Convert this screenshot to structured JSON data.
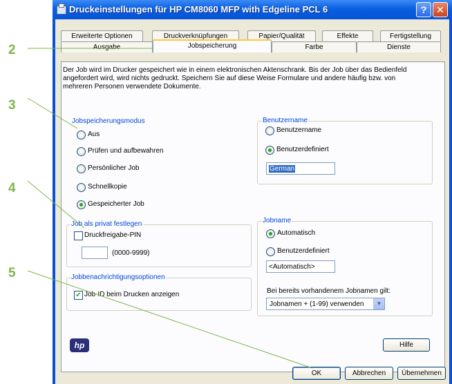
{
  "callouts": [
    "2",
    "3",
    "4",
    "5"
  ],
  "window": {
    "title": "Druckeinstellungen für HP CM8060 MFP with Edgeline PCL 6",
    "help_btn": "?",
    "close_btn": "✕"
  },
  "tabs_row1": [
    "Erweiterte Optionen",
    "Druckverknüpfungen",
    "Papier/Qualität",
    "Effekte",
    "Fertigstellung"
  ],
  "tabs_row2": [
    "Ausgabe",
    "Jobspeicherung",
    "Farbe",
    "Dienste"
  ],
  "description": "Der Job wird im Drucker gespeichert wie in einem elektronischen Aktenschrank. Bis der Job über das Bedienfeld angefordert wird, wird nichts gedruckt. Speichern Sie auf diese Weise Formulare und andere häufig bzw. von mehreren Personen verwendete Dokumente.",
  "mode_group": {
    "label": "Jobspeicherungsmodus",
    "options": [
      "Aus",
      "Prüfen und aufbewahren",
      "Persönlicher Job",
      "Schnellkopie",
      "Gespeicherter Job"
    ],
    "selected": "Gespeicherter Job"
  },
  "private_group": {
    "label": "Job als privat festlegen",
    "checkbox": "Druckfreigabe-PIN",
    "pin_value": "",
    "pin_hint": "(0000-9999)"
  },
  "notify_group": {
    "label": "Jobbenachrichtigungsoptionen",
    "checkbox": "Job-ID beim Drucken anzeigen",
    "checked": true
  },
  "user_group": {
    "label": "Benutzername",
    "options": [
      "Benutzername",
      "Benutzerdefiniert"
    ],
    "selected": "Benutzerdefiniert",
    "value": "German"
  },
  "jobname_group": {
    "label": "Jobname",
    "options": [
      "Automatisch",
      "Benutzerdefiniert"
    ],
    "selected": "Automatisch",
    "value": "<Automatisch>",
    "exists_label": "Bei bereits vorhandenem Jobnamen gilt:",
    "exists_value": "Jobnamen + (1-99) verwenden"
  },
  "logo": "hp",
  "buttons": {
    "help": "Hilfe",
    "ok": "OK",
    "cancel": "Abbrechen",
    "apply": "Übernehmen"
  },
  "colors": {
    "callout": "#7ab648",
    "titlebar": "#0a5fe0",
    "group_label": "#0046d5",
    "active_tab": "#ffc83c"
  }
}
